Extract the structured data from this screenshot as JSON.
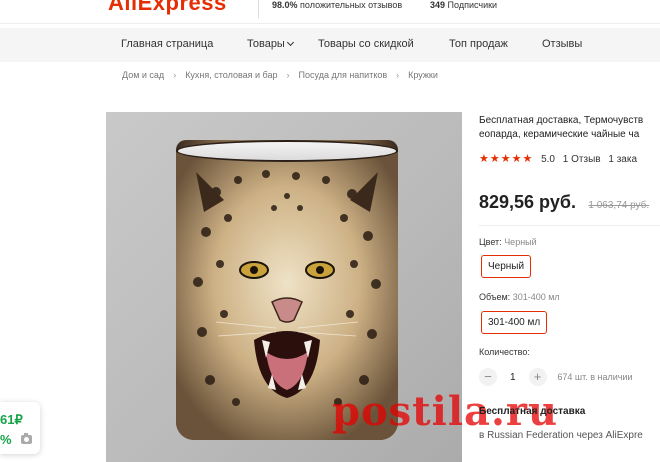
{
  "header": {
    "logo": "AliExpress",
    "positive_pct": "98.0%",
    "positive_label": "положительных отзывов",
    "subscribers_count": "349",
    "subscribers_label": "Подписчики"
  },
  "nav": {
    "items": [
      {
        "label": "Главная страница"
      },
      {
        "label": "Товары"
      },
      {
        "label": "Товары со скидкой"
      },
      {
        "label": "Топ продаж"
      },
      {
        "label": "Отзывы"
      }
    ]
  },
  "breadcrumb": [
    "Дом и сад",
    "Кухня, столовая и бар",
    "Посуда для напитков",
    "Кружки"
  ],
  "product": {
    "title_line1": "Бесплатная доставка, Термочувств",
    "title_line2": "еопарда, керамические чайные ча",
    "rating": "5.0",
    "reviews": "1 Отзыв",
    "orders": "1 зака",
    "price": "829,56 руб.",
    "old_price": "1 063,74 руб."
  },
  "options": {
    "color_label": "Цвет:",
    "color_value": "Черный",
    "color_button": "Черный",
    "volume_label": "Объем:",
    "volume_value": "301-400 мл",
    "volume_button": "301-400 мл"
  },
  "quantity": {
    "label": "Количество:",
    "value": "1",
    "minus": "−",
    "plus": "+",
    "stock": "674 шт. в наличии"
  },
  "shipping": {
    "title": "Бесплатная доставка",
    "subtitle": "в Russian Federation через AliExpre"
  },
  "watermark": "postila.ru",
  "side_widget": {
    "price": "61₽",
    "pct": "%"
  },
  "colors": {
    "brand": "#e62e04",
    "green": "#17a34a"
  }
}
